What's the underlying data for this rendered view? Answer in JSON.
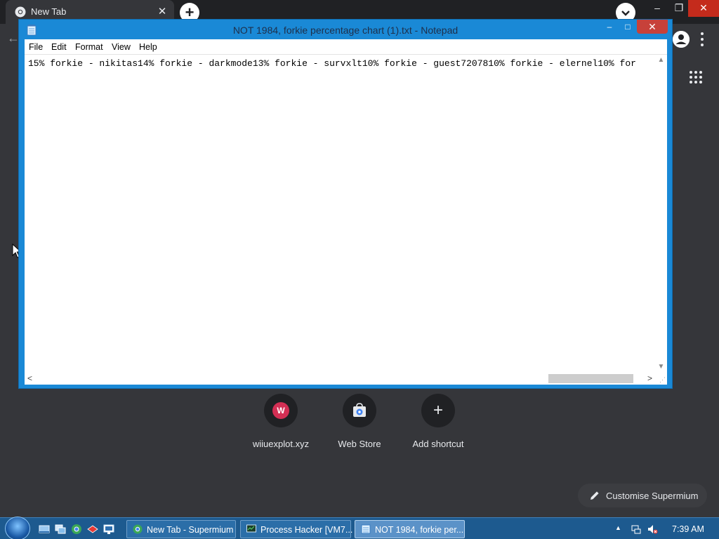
{
  "browser": {
    "tab_title": "New Tab",
    "tab_close": "✕",
    "new_tab_symbol": "+",
    "back_symbol": "←",
    "window_min": "–",
    "window_max": "❐",
    "window_close": "✕"
  },
  "newtab_page": {
    "shortcuts": [
      {
        "label": "wiiuexplot.xyz",
        "badge": "W",
        "icon": "site-favicon"
      },
      {
        "label": "Web Store",
        "icon": "web-store-icon"
      },
      {
        "label": "Add shortcut",
        "icon": "plus-icon",
        "symbol": "+"
      }
    ],
    "customise_label": "Customise Supermium"
  },
  "notepad": {
    "title": "NOT 1984, forkie percentage chart (1).txt - Notepad",
    "menu": [
      "File",
      "Edit",
      "Format",
      "View",
      "Help"
    ],
    "content": "15% forkie - nikitas14% forkie - darkmode13% forkie - survxlt10% forkie - guest7207810% forkie - elernel10% for",
    "min_symbol": "–",
    "max_symbol": "□",
    "close_symbol": "✕",
    "scroll_up": "▲",
    "scroll_down": "▼",
    "scroll_left": "<",
    "scroll_right": ">"
  },
  "taskbar": {
    "buttons": [
      {
        "label": "New Tab - Supermium",
        "icon": "chrome-icon",
        "active": false
      },
      {
        "label": "Process Hacker [VM7...",
        "icon": "process-hacker-icon",
        "active": false
      },
      {
        "label": "NOT 1984, forkie per...",
        "icon": "notepad-icon",
        "active": true
      }
    ],
    "tray_arrow": "▲",
    "clock": "7:39 AM"
  },
  "colors": {
    "chrome_bg": "#35363a",
    "notepad_frame": "#1a89d6",
    "taskbar": "#1d5a8f",
    "close_red": "#c7413a"
  }
}
